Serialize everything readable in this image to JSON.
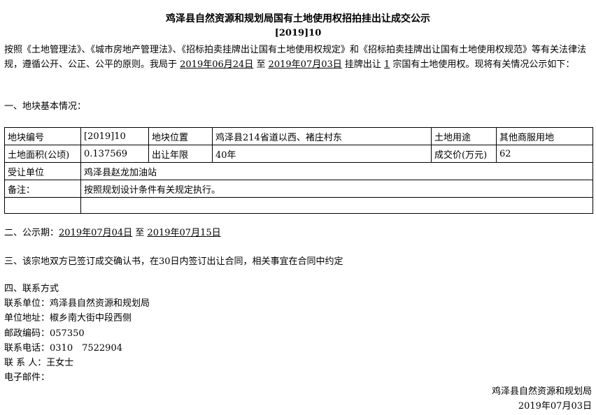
{
  "title": "鸡泽县自然资源和规划局国有土地使用权招拍挂出让成交公示",
  "doc_no": "[2019]10",
  "intro": {
    "p1": "按照《土地管理法》、《城市房地产管理法》、《招标拍卖挂牌出让国有土地使用权规定》和《招标拍卖挂牌出让国有土地使用权规范》等有关法律法规，遵循公开、公正、公平的原则。我局于 ",
    "date_start": "2019年06月24日",
    "to": " 至 ",
    "date_end": "2019年07月03日",
    "p2": " 挂牌出让 ",
    "count": "1",
    "p3": " 宗国有土地使用权。现将有关情况公示如下："
  },
  "section1": "一、地块基本情况：",
  "table": {
    "r1": [
      "地块编号",
      "[2019]10",
      "地块位置",
      "鸡泽县214省道以西、褚庄村东",
      "土地用途",
      "其他商服用地"
    ],
    "r2": [
      "土地面积(公顷)",
      "0.137569",
      "出让年限",
      "40年",
      "成交价(万元)",
      "62"
    ],
    "r3": [
      "受让单位",
      "鸡泽县赵龙加油站"
    ],
    "r4": [
      "备注：",
      "按照规划设计条件有关规定执行。"
    ]
  },
  "section2": {
    "label": "二、公示期：",
    "start": "2019年07月04日",
    "to": " 至 ",
    "end": "2019年07月15日"
  },
  "section3": "三、该宗地双方已签订成交确认书，在30日内签订出让合同，相关事宜在合同中约定",
  "section4": {
    "heading": "四、联系方式",
    "unit": "联系单位：鸡泽县自然资源和规划局",
    "address": "单位地址：椒乡南大街中段西侧",
    "postcode": "邮政编码：057350",
    "phone": "联系电话：0310　7522904",
    "contact": "联 系 人：王女士",
    "email": "电子邮件："
  },
  "footer": {
    "org": "鸡泽县自然资源和规划局",
    "date": "2019年07月03日"
  }
}
